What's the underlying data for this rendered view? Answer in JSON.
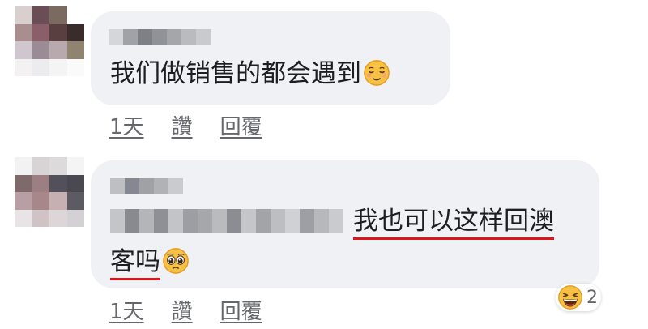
{
  "comments": [
    {
      "text": "我们做销售的都会遇到",
      "emoji": "relieved-face-emoji",
      "actions": [
        "1天",
        "讚",
        "回覆"
      ]
    },
    {
      "text_line1": "我也可以这样回澳",
      "text_line2": "客吗",
      "emoji": "pleading-face-emoji",
      "actions": [
        "1天",
        "讚",
        "回覆"
      ],
      "reaction": {
        "emoji": "laughing-face-emoji",
        "count": "2"
      }
    }
  ],
  "colors": {
    "bubble": "#eff1f4",
    "text": "#1c1e21",
    "meta": "#65676b",
    "underline": "#e0121a"
  }
}
